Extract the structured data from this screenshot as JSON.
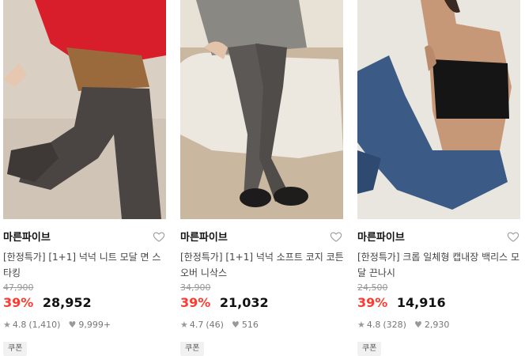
{
  "products": [
    {
      "brand": "마른파이브",
      "title": "[한정특가] [1+1] 넉넉 니트 모달 면 스타킹",
      "original_price": "47,900",
      "discount": "39%",
      "price": "28,952",
      "rating": "4.8",
      "reviews": "(1,410)",
      "likes": "9,999+",
      "badge": "쿠폰",
      "image_icon": "tights-photo"
    },
    {
      "brand": "마른파이브",
      "title": "[한정특가] [1+1] 넉넉 소프트 코지 코튼 오버 니삭스",
      "original_price": "34,900",
      "discount": "39%",
      "price": "21,032",
      "rating": "4.7",
      "reviews": "(46)",
      "likes": "516",
      "badge": "쿠폰",
      "image_icon": "knee-socks-photo"
    },
    {
      "brand": "마른파이브",
      "title": "[한정특가] 크롭 일체형 캡내장 백리스 모달 끈나시",
      "original_price": "24,500",
      "discount": "39%",
      "price": "14,916",
      "rating": "4.8",
      "reviews": "(328)",
      "likes": "2,930",
      "badge": "쿠폰",
      "image_icon": "crop-top-photo"
    }
  ],
  "colors": {
    "discount": "#ff3b30",
    "price": "#111111",
    "muted": "#999999"
  }
}
